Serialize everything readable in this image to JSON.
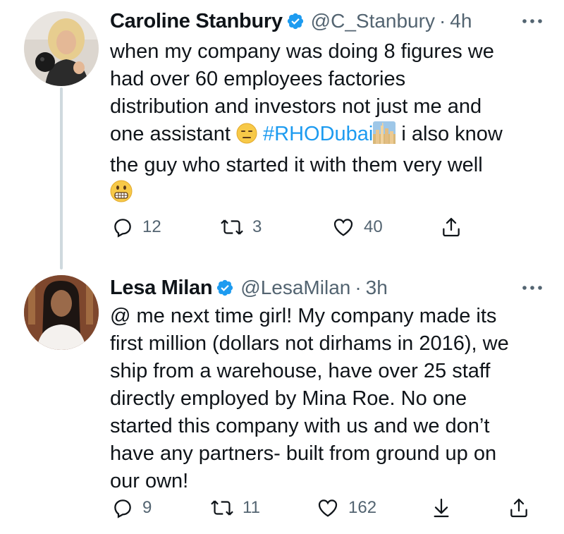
{
  "thread": {
    "tweets": [
      {
        "name": "Caroline Stanbury",
        "handle": "@C_Stanbury",
        "separator": "·",
        "time": "4h",
        "verified": true,
        "text": {
          "line1": "when my company was doing 8 figures we",
          "line2": "had over 60 employees factories",
          "line3": "distribution and investors not just me and",
          "line4_before": "one assistant",
          "hashtag": "#RHODubai",
          "line4_after": "i also know",
          "line5": "the guy who started it with them very well"
        },
        "emojis": [
          "expressionless-face",
          "cityscape",
          "grimacing-face"
        ],
        "actions": {
          "reply_count": "12",
          "retweet_count": "3",
          "like_count": "40"
        }
      },
      {
        "name": "Lesa Milan",
        "handle": "@LesaMilan",
        "separator": "·",
        "time": "3h",
        "verified": true,
        "text": {
          "line1": "@ me next time girl! My company made its",
          "line2": "first million (dollars not dirhams in 2016), we",
          "line3": "ship from a warehouse, have over 25 staff",
          "line4": "directly employed by Mina Roe. No one",
          "line5": "started this company with us and we don’t",
          "line6": "have any partners- built from ground up on",
          "line7": "our own!"
        },
        "actions": {
          "reply_count": "9",
          "retweet_count": "11",
          "like_count": "162"
        }
      }
    ]
  },
  "colors": {
    "text": "#0f1419",
    "secondary": "#536471",
    "link": "#1d9bf0",
    "verified": "#1d9bf0",
    "thread_line": "#cfd9de"
  }
}
